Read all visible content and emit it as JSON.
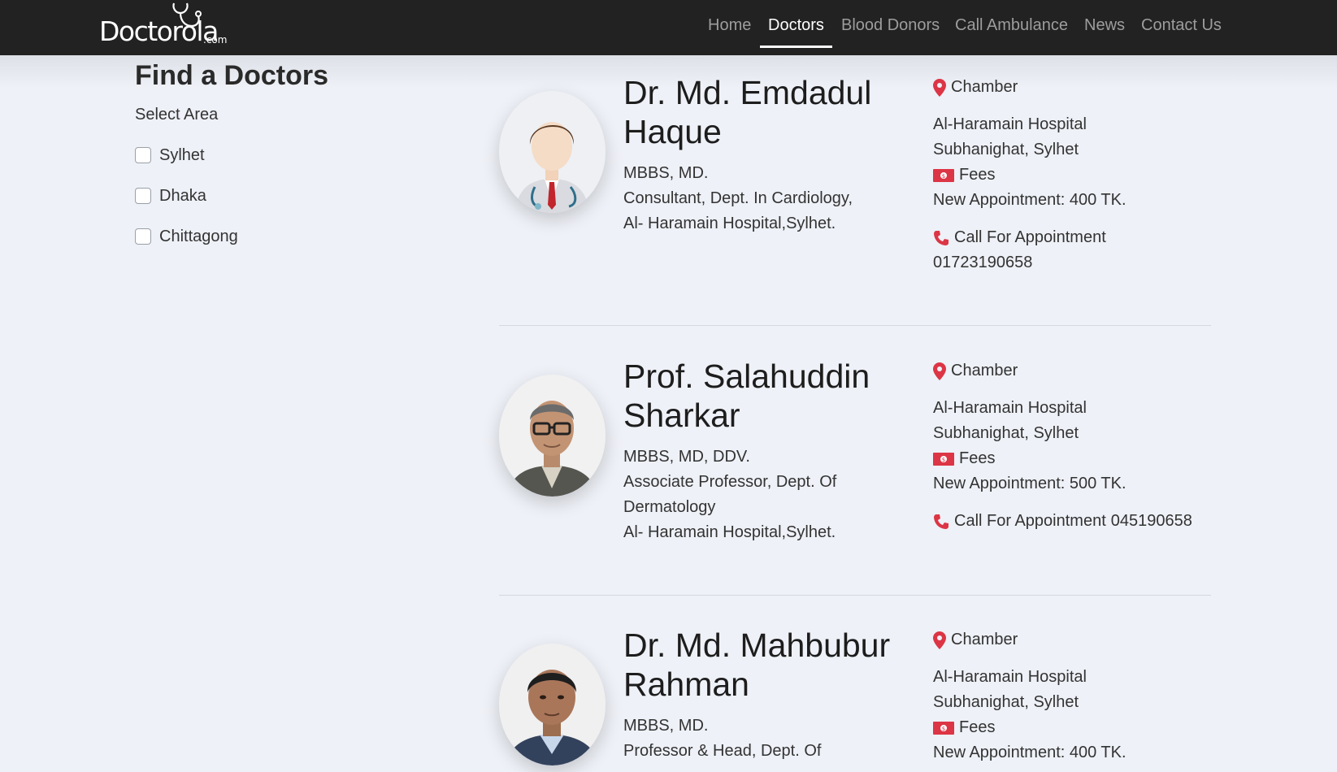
{
  "brand": {
    "name": "Doctorola",
    "suffix": ".com"
  },
  "nav": {
    "items": [
      {
        "label": "Home",
        "active": false
      },
      {
        "label": "Doctors",
        "active": true
      },
      {
        "label": "Blood Donors",
        "active": false
      },
      {
        "label": "Call Ambulance",
        "active": false
      },
      {
        "label": "News",
        "active": false
      },
      {
        "label": "Contact Us",
        "active": false
      }
    ]
  },
  "sidebar": {
    "title": "Find a Doctors",
    "subtitle": "Select Area",
    "areas": [
      {
        "label": "Sylhet",
        "checked": false
      },
      {
        "label": "Dhaka",
        "checked": false
      },
      {
        "label": "Chittagong",
        "checked": false
      }
    ]
  },
  "doctors": [
    {
      "name": "Dr. Md. Emdadul Haque",
      "degrees": "MBBS, MD.",
      "position": "Consultant, Dept. In Cardiology,",
      "hospital": "Al- Haramain Hospital,Sylhet.",
      "chamber_label": "Chamber",
      "chamber_name": "Al-Haramain Hospital",
      "chamber_address": "Subhanighat, Sylhet",
      "fees_label": "Fees",
      "fees_value": "New Appointment: 400 TK.",
      "call_label": "Call For Appointment",
      "phone": "01723190658"
    },
    {
      "name": "Prof. Salahuddin Sharkar",
      "degrees": "MBBS, MD, DDV.",
      "position": "Associate Professor, Dept. Of Dermatology",
      "hospital": "Al- Haramain Hospital,Sylhet.",
      "chamber_label": "Chamber",
      "chamber_name": "Al-Haramain Hospital",
      "chamber_address": "Subhanighat, Sylhet",
      "fees_label": "Fees",
      "fees_value": "New Appointment: 500 TK.",
      "call_label": "Call For Appointment",
      "phone": "045190658"
    },
    {
      "name": "Dr. Md. Mahbubur Rahman",
      "degrees": "MBBS, MD.",
      "position": "Professor & Head, Dept. Of",
      "hospital": "",
      "chamber_label": "Chamber",
      "chamber_name": "Al-Haramain Hospital",
      "chamber_address": "Subhanighat, Sylhet",
      "fees_label": "Fees",
      "fees_value": "New Appointment: 400 TK.",
      "call_label": "",
      "phone": ""
    }
  ],
  "icons": {
    "location": "map-marker-icon",
    "fees": "money-bill-icon",
    "phone": "phone-icon",
    "accent": "#dc3545"
  }
}
